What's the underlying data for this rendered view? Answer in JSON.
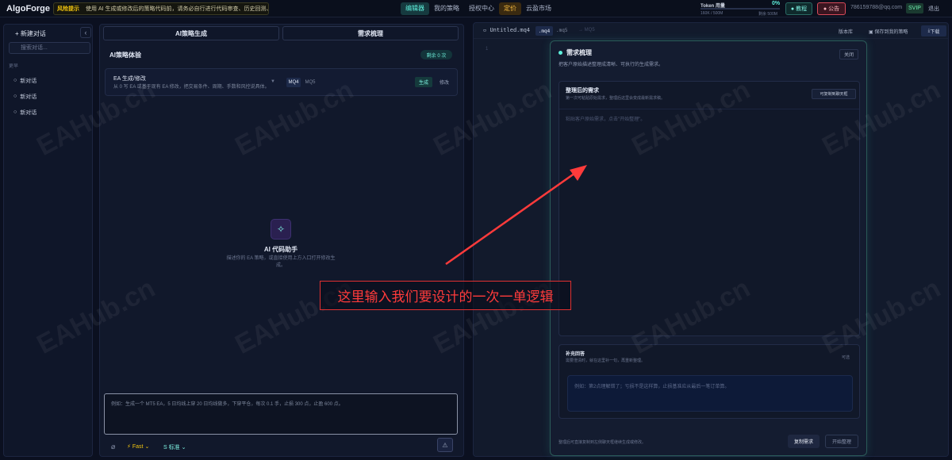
{
  "app": {
    "logo": "AlgoForge",
    "risk_tag": "风险提示",
    "risk_text": "使用 AI 生成或修改后的策略代码前，请务必自行进行代码审查、历史回测、i"
  },
  "nav": [
    {
      "label": "编辑器",
      "state": "active"
    },
    {
      "label": "我的策略",
      "state": "normal"
    },
    {
      "label": "授权中心",
      "state": "normal"
    },
    {
      "label": "定价",
      "state": "highlight"
    },
    {
      "label": "云盈市场",
      "state": "normal"
    }
  ],
  "token": {
    "label": "Token 用量",
    "percent": "0%",
    "usage": "160K / 500M",
    "remaining": "剩余 500M",
    "fill_fraction": 0.0
  },
  "header_buttons": {
    "tutorial": "教程",
    "notice": "公告",
    "email": "786159788@qq.com",
    "tier": "SVIP",
    "logout": "退出"
  },
  "sidebar": {
    "new_chat": "+ 新建对话",
    "collapse_icon": "‹",
    "search_placeholder": "搜索对话...",
    "section": "更早",
    "items": [
      {
        "label": "新对话"
      },
      {
        "label": "新对话"
      },
      {
        "label": "新对话"
      }
    ]
  },
  "mid": {
    "tabs": [
      "AI策略生成",
      "需求梳理"
    ],
    "experience_title": "AI策略体验",
    "remaining": "剩余 0 次",
    "ea_card": {
      "title": "EA 生成/修改",
      "desc": "从 0 写 EA 或基于现有 EA 修改，把交易条件、周期、手数和风控说具体。",
      "lang_on": "MQ4",
      "lang_off": "MQ5",
      "generate": "生成",
      "modify": "修改"
    },
    "assistant": {
      "icon": "bulb-icon",
      "title": "AI 代码助手",
      "desc": "描述你的 EA 策略，或直接使用上方入口打开修改生成。"
    },
    "prompt_placeholder": "例如：生成一个 MT5 EA，5 日均线上穿 20 日均线做多，下穿平仓，每次 0.1 手，止损 300 点，止盈 600 点。",
    "toolbar": {
      "attach_icon": "paperclip-icon",
      "fast": "Fast",
      "standard": "S 标准"
    }
  },
  "editor": {
    "file_name": "Untitled.mq4",
    "ext_on": ".mq4",
    "ext_off": ".mq5",
    "mq5_hint": "MQ5",
    "version_lib": "版本库",
    "save_strategy": "保存到我的策略",
    "download": "下载",
    "line_no": "1"
  },
  "modal": {
    "title": "需求梳理",
    "subtitle": "把客户原始描述整理成清晰、可执行的生成需求。",
    "close": "关闭",
    "sec1_title": "整理后的需求",
    "sec1_sub": "第一次可粘贴原始需求，整理后这里会变成最新需求稿。",
    "copy_to_chat": "可复制到聊天框",
    "req_placeholder": "粘贴客户原始需求，点击\"开始整理\"。",
    "sec2_title": "补充回答",
    "sec2_sub": "需要澄清时，就在这里补一句，再重新整理。",
    "optional": "可选",
    "sup_placeholder": "例如：第2点理解错了；亏损不是这样算，止损基准应从最后一笔订单算。",
    "footer": "整理后可直接复制到左侧聊天框继续生成或修改。",
    "copy_req": "复制需求",
    "start": "开始整理"
  },
  "annotation": {
    "text": "这里输入我们要设计的一次一单逻辑",
    "color": "#ff3b3b"
  },
  "watermark": "EAHub.cn"
}
